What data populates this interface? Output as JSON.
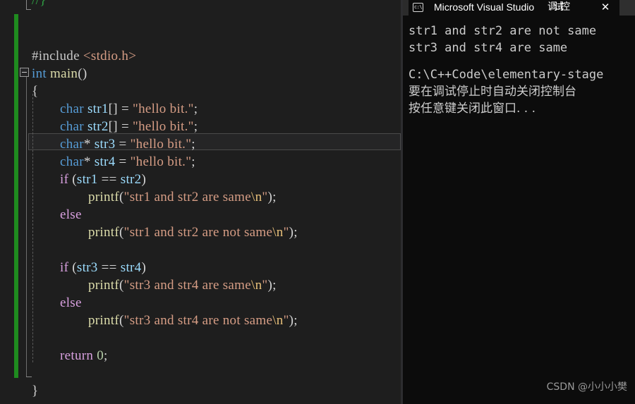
{
  "editor": {
    "partial_top_line": "//}",
    "lines": [
      {
        "indent": 0,
        "tokens": [
          {
            "t": "#include ",
            "c": "pp"
          },
          {
            "t": "<stdio.h>",
            "c": "str"
          }
        ]
      },
      {
        "indent": 0,
        "tokens": [
          {
            "t": "int",
            "c": "kw"
          },
          {
            "t": " ",
            "c": "plain"
          },
          {
            "t": "main",
            "c": "fn"
          },
          {
            "t": "()",
            "c": "punc"
          }
        ]
      },
      {
        "indent": 0,
        "tokens": [
          {
            "t": "{",
            "c": "punc"
          }
        ]
      },
      {
        "indent": 1,
        "tokens": [
          {
            "t": "char",
            "c": "kw"
          },
          {
            "t": " ",
            "c": "plain"
          },
          {
            "t": "str1",
            "c": "var"
          },
          {
            "t": "[] = ",
            "c": "punc"
          },
          {
            "t": "\"hello bit.\"",
            "c": "str"
          },
          {
            "t": ";",
            "c": "punc"
          }
        ]
      },
      {
        "indent": 1,
        "tokens": [
          {
            "t": "char",
            "c": "kw"
          },
          {
            "t": " ",
            "c": "plain"
          },
          {
            "t": "str2",
            "c": "var"
          },
          {
            "t": "[] = ",
            "c": "punc"
          },
          {
            "t": "\"hello bit.\"",
            "c": "str"
          },
          {
            "t": ";",
            "c": "punc"
          }
        ]
      },
      {
        "indent": 1,
        "tokens": [
          {
            "t": "char",
            "c": "kw"
          },
          {
            "t": "* ",
            "c": "punc"
          },
          {
            "t": "str3",
            "c": "var"
          },
          {
            "t": " = ",
            "c": "punc"
          },
          {
            "t": "\"hello bit.\"",
            "c": "str"
          },
          {
            "t": ";",
            "c": "punc"
          }
        ]
      },
      {
        "indent": 1,
        "tokens": [
          {
            "t": "char",
            "c": "kw"
          },
          {
            "t": "* ",
            "c": "punc"
          },
          {
            "t": "str4",
            "c": "var"
          },
          {
            "t": " = ",
            "c": "punc"
          },
          {
            "t": "\"hello bit.\"",
            "c": "str"
          },
          {
            "t": ";",
            "c": "punc"
          }
        ]
      },
      {
        "indent": 1,
        "tokens": [
          {
            "t": "if",
            "c": "ctrl"
          },
          {
            "t": " (",
            "c": "punc"
          },
          {
            "t": "str1",
            "c": "var"
          },
          {
            "t": " == ",
            "c": "punc"
          },
          {
            "t": "str2",
            "c": "var"
          },
          {
            "t": ")",
            "c": "punc"
          }
        ]
      },
      {
        "indent": 2,
        "tokens": [
          {
            "t": "printf",
            "c": "fn"
          },
          {
            "t": "(",
            "c": "punc"
          },
          {
            "t": "\"str1 and str2 are same",
            "c": "str"
          },
          {
            "t": "\\n",
            "c": "esc"
          },
          {
            "t": "\"",
            "c": "str"
          },
          {
            "t": ");",
            "c": "punc"
          }
        ]
      },
      {
        "indent": 1,
        "tokens": [
          {
            "t": "else",
            "c": "ctrl"
          }
        ]
      },
      {
        "indent": 2,
        "tokens": [
          {
            "t": "printf",
            "c": "fn"
          },
          {
            "t": "(",
            "c": "punc"
          },
          {
            "t": "\"str1 and str2 are not same",
            "c": "str"
          },
          {
            "t": "\\n",
            "c": "esc"
          },
          {
            "t": "\"",
            "c": "str"
          },
          {
            "t": ");",
            "c": "punc"
          }
        ]
      },
      {
        "indent": 0,
        "tokens": []
      },
      {
        "indent": 1,
        "tokens": [
          {
            "t": "if",
            "c": "ctrl"
          },
          {
            "t": " (",
            "c": "punc"
          },
          {
            "t": "str3",
            "c": "var"
          },
          {
            "t": " == ",
            "c": "punc"
          },
          {
            "t": "str4",
            "c": "var"
          },
          {
            "t": ")",
            "c": "punc"
          }
        ]
      },
      {
        "indent": 2,
        "tokens": [
          {
            "t": "printf",
            "c": "fn"
          },
          {
            "t": "(",
            "c": "punc"
          },
          {
            "t": "\"str3 and str4 are same",
            "c": "str"
          },
          {
            "t": "\\n",
            "c": "esc"
          },
          {
            "t": "\"",
            "c": "str"
          },
          {
            "t": ");",
            "c": "punc"
          }
        ]
      },
      {
        "indent": 1,
        "tokens": [
          {
            "t": "else",
            "c": "ctrl"
          }
        ]
      },
      {
        "indent": 2,
        "tokens": [
          {
            "t": "printf",
            "c": "fn"
          },
          {
            "t": "(",
            "c": "punc"
          },
          {
            "t": "\"str3 and str4 are not same",
            "c": "str"
          },
          {
            "t": "\\n",
            "c": "esc"
          },
          {
            "t": "\"",
            "c": "str"
          },
          {
            "t": ");",
            "c": "punc"
          }
        ]
      },
      {
        "indent": 0,
        "tokens": []
      },
      {
        "indent": 1,
        "tokens": [
          {
            "t": "return",
            "c": "ctrl"
          },
          {
            "t": " ",
            "c": "plain"
          },
          {
            "t": "0",
            "c": "num"
          },
          {
            "t": ";",
            "c": "punc"
          }
        ]
      },
      {
        "indent": 0,
        "tokens": []
      },
      {
        "indent": 0,
        "tokens": [
          {
            "t": "}",
            "c": "punc"
          }
        ]
      }
    ],
    "current_line_index": 5,
    "colors": {
      "background": "#1e1e1e",
      "change_bar": "#1f8b1f",
      "keyword": "#569cd6",
      "control": "#d8a0df",
      "string": "#d69d85",
      "escape": "#e8c07a",
      "function": "#dcdcaa",
      "variable": "#9cdcfe",
      "number": "#b5cea8",
      "comment": "#2ea043",
      "current_line_bg": "#252526"
    }
  },
  "console": {
    "icon": "console-cmd-icon",
    "title": "Microsoft Visual Studio ",
    "title_cn": "调试控",
    "close_label": "✕",
    "output": [
      {
        "text": "str1 and str2 are not same",
        "kind": "ascii"
      },
      {
        "text": "str3 and str4 are same",
        "kind": "ascii"
      },
      {
        "text": "",
        "kind": "blank"
      },
      {
        "text": "C:\\C++Code\\elementary-stage",
        "kind": "ascii"
      },
      {
        "text": "要在调试停止时自动关闭控制台",
        "kind": "cn"
      },
      {
        "text": "按任意键关闭此窗口. . .",
        "kind": "cn"
      }
    ],
    "colors": {
      "background": "#0c0c0c",
      "text": "#cccccc",
      "titlebar_text": "#ffffff"
    }
  },
  "watermark": {
    "text": "CSDN @小小小樊"
  }
}
